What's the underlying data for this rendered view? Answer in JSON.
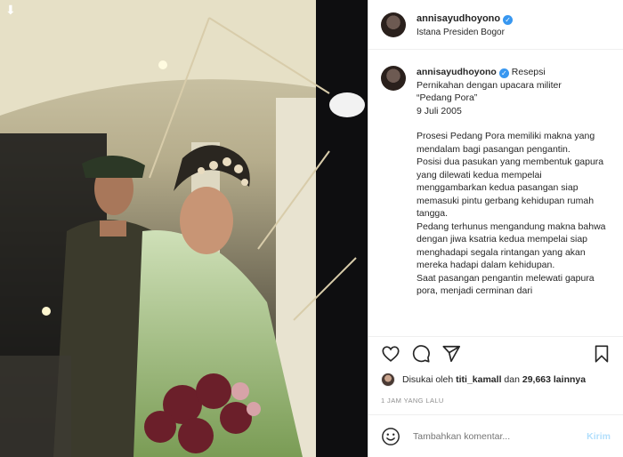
{
  "post": {
    "username": "annisayudhoyono",
    "location": "Istana Presiden Bogor",
    "verified": true
  },
  "caption": {
    "username": "annisayudhoyono",
    "lines": [
      "Resepsi",
      "Pernikahan dengan upacara militer",
      "“Pedang Pora”",
      "9 Juli 2005"
    ],
    "body": [
      "Prosesi Pedang Pora memiliki makna yang mendalam bagi pasangan pengantin.",
      "Posisi dua pasukan yang membentuk gapura yang dilewati kedua mempelai menggambarkan kedua pasangan siap memasuki pintu gerbang kehidupan rumah tangga.",
      "Pedang terhunus mengandung makna bahwa dengan jiwa ksatria kedua mempelai siap menghadapi segala rintangan yang akan mereka hadapi dalam kehidupan.",
      "Saat pasangan pengantin melewati gapura pora, menjadi cerminan dari"
    ]
  },
  "likes": {
    "prefix": "Disukai oleh",
    "user": "titi_kamall",
    "joiner": "dan",
    "count": "29,663 lainnya"
  },
  "time": "1 JAM YANG LALU",
  "comment_box": {
    "placeholder": "Tambahkan komentar...",
    "post_label": "Kirim"
  },
  "icons": {
    "like": "heart-icon",
    "comment": "comment-icon",
    "share": "share-icon",
    "save": "bookmark-icon",
    "emoji": "emoji-icon",
    "verified": "verified-badge-icon",
    "photo_corner": "arrow-down-icon"
  },
  "colors": {
    "verified": "#3897f0",
    "link_disabled": "#b2dffc",
    "muted": "#8e8e8e"
  }
}
